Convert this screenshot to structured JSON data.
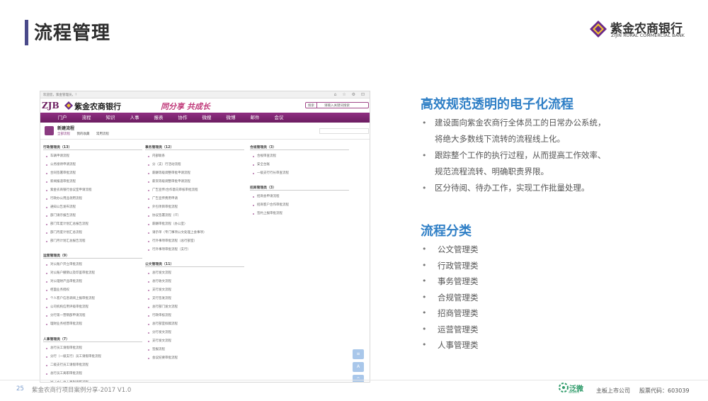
{
  "slide": {
    "title": "流程管理",
    "logo_cn": "紫金农商银行",
    "logo_en": "ZIJIN RURAL COMMERCIAL BANK"
  },
  "screenshot": {
    "browser_tab": "欢迎您，紫金管理员，！",
    "browser_icons": "⌂ ☆ ⚙ ⊡",
    "bank_zjb": "ZJB",
    "bank_name": "紫金农商银行",
    "slogan": "同分享 共成长",
    "search_btn": "搜索",
    "search_placeholder": "请输入关键词搜索",
    "nav": [
      "门户",
      "流程",
      "知识",
      "人事",
      "报表",
      "协作",
      "微搜",
      "微博",
      "邮件",
      "会议"
    ],
    "proc_title": "新建流程",
    "proc_tabs": [
      "全部流程",
      "我的收藏",
      "常用流程"
    ],
    "categories": [
      {
        "title": "行政管理类（13）",
        "items": [
          "车辆申请流程",
          "公务接待申请流程",
          "合同签署审批流程",
          "新闻报道审批流程",
          "紫金农商银行会议室申请流程",
          "行政办公用品领用流程",
          "通知公告发布流程",
          "部门请示报告流程",
          "部门年度计划汇总报告流程",
          "部门月度计划汇总流程",
          "部门月计划汇总报告流程"
        ]
      },
      {
        "title": "事务管理类（12）",
        "items": [
          "内部联系",
          "分（支）行活动流程",
          "薪酬等级调整审批申请流程",
          "薪资等级调整审批申请流程",
          "广告宣传/合作意向审核审批流程",
          "广告宣传费用申请",
          "外包项目审批流程",
          "协议签署流程（IT）",
          "薪酬审批流程（办公室）",
          "请示单（专门事项公文处理上会事项）",
          "行外事项审批流程（总行部室）",
          "行外事项审批流程（支行）"
        ]
      },
      {
        "title": "合规管理类（3）",
        "items": [
          "合规审查流程",
          "安全台账",
          "一级支行行长审查流程"
        ]
      },
      {
        "title": "招商管理类（3）",
        "items": [
          "招商会申请流程",
          "招商客户合作审批流程",
          "签约上报审批流程"
        ]
      },
      {
        "title": "运营管理类（9）",
        "items": [
          "对公账户开立审批流程",
          "对公账户撤销以及印鉴审批流程",
          "对公理财产品审批流程",
          "柜面业务授权",
          "个人客户信息调阅上报审批流程",
          "公司机构信用评级审批流程",
          "分行第一营销部申请流程",
          "理财业务经营审批流程"
        ]
      },
      {
        "title": "公文管理类（11）",
        "items": [
          "总行发文流程",
          "总行收文流程",
          "支行发文流程",
          "支行签发流程",
          "总行部门发文流程",
          "行政审核流程",
          "总行部室拟稿流程",
          "分行发文流程",
          "支行发文流程",
          "签报流程",
          "会议纪要审批流程"
        ]
      },
      {
        "title": "人事管理类（7）",
        "items": [
          "总行员工请假审批流程",
          "分行（一级支行）员工请假审批流程",
          "二级支行员工请假审批流程",
          "总行员工离职审批流程",
          "分（支）员工离职审批流程"
        ]
      }
    ]
  },
  "main": {
    "heading1": "高效规范透明的电子化流程",
    "bullets": [
      "建设面向紫金农商行全体员工的日常办公系统，将绝大多数线下流转的流程线上化。",
      "跟踪整个工作的执行过程，从而提高工作效率、规范流程流转、明确职责界限。",
      "区分待阅、待办工作，实现工作批量处理。"
    ],
    "heading2": "流程分类",
    "categories": [
      "公文管理类",
      "行政管理类",
      "事务管理类",
      "合规管理类",
      "招商管理类",
      "运营管理类",
      "人事管理类"
    ]
  },
  "footer": {
    "page": "25",
    "title": "紫金农商行项目案例分享-2017 V1.0",
    "fw_name": "泛微",
    "fw_sub": "WEAVER",
    "listed": "主板上市公司",
    "stock": "股票代码：603039"
  },
  "colors": {
    "accent_blue": "#2f7fc6",
    "brand_purple": "#6c1d61",
    "title_bar": "#4a4a8a"
  }
}
